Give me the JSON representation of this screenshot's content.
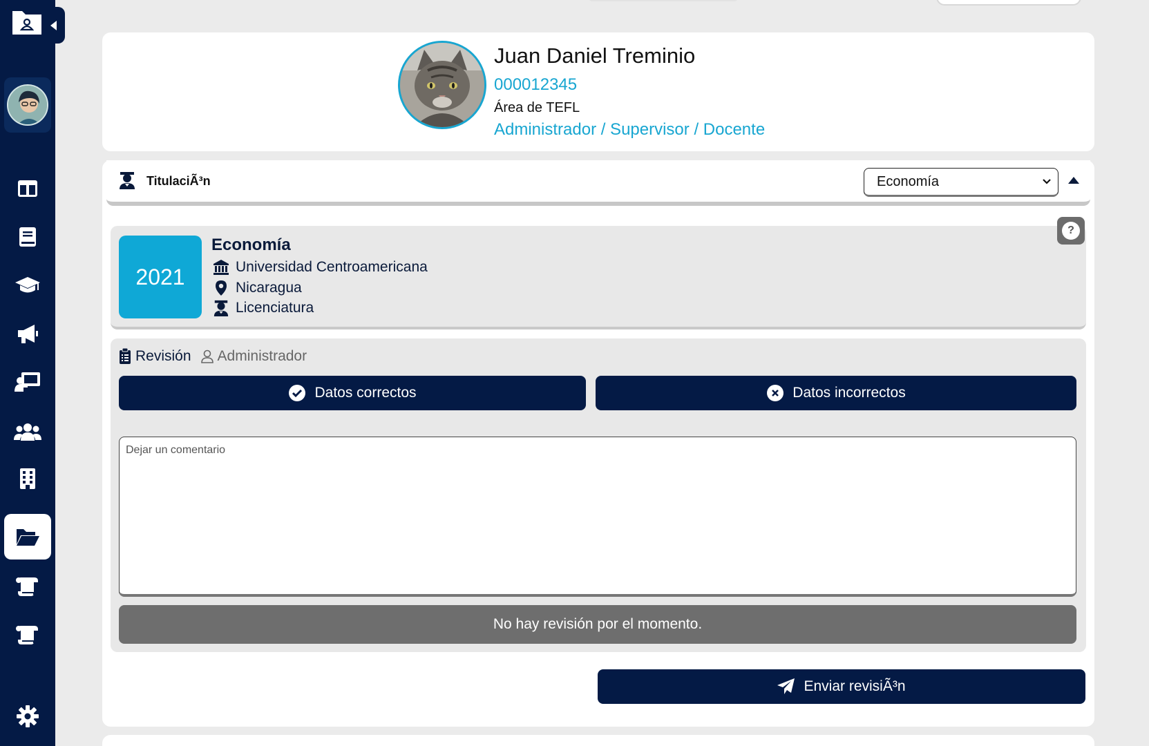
{
  "profile": {
    "name": "Juan Daniel Treminio",
    "id": "000012345",
    "area": "Área de TEFL",
    "roles": "Administrador / Supervisor / Docente"
  },
  "section": {
    "title": "TitulaciÃ³n",
    "selected_degree": "Economía"
  },
  "degree": {
    "year": "2021",
    "title": "Economía",
    "institution": "Universidad Centroamericana",
    "country": "Nicaragua",
    "level": "Licenciatura",
    "help_label": "?"
  },
  "review": {
    "title": "Revisión",
    "role": "Administrador",
    "correct_label": "Datos correctos",
    "incorrect_label": "Datos incorrectos",
    "comment_placeholder": "Dejar un comentario",
    "status": "No hay revisión por el momento.",
    "send_label": "Enviar revisiÃ³n"
  },
  "sidebar": {
    "items": [
      {
        "icon": "dashboard-icon"
      },
      {
        "icon": "book-icon"
      },
      {
        "icon": "graduation-cap-icon"
      },
      {
        "icon": "megaphone-icon"
      },
      {
        "icon": "teacher-board-icon"
      },
      {
        "icon": "users-icon"
      },
      {
        "icon": "building-icon"
      },
      {
        "icon": "folder-open-icon",
        "active": true
      },
      {
        "icon": "scroll-icon"
      },
      {
        "icon": "scroll-icon"
      },
      {
        "icon": "gear-icon"
      }
    ]
  },
  "colors": {
    "sidebar": "#041a45",
    "accent": "#18a6d1",
    "badge": "#0fa8d6",
    "status_bg": "#6e6e6e"
  }
}
